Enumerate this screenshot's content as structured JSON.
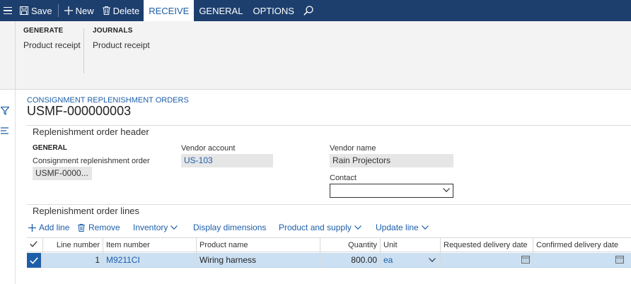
{
  "toolbar": {
    "save_label": "Save",
    "new_label": "New",
    "delete_label": "Delete",
    "tabs": [
      "RECEIVE",
      "GENERAL",
      "OPTIONS"
    ],
    "active_tab": "RECEIVE"
  },
  "ribbon": {
    "groups": [
      {
        "header": "GENERATE",
        "items": [
          "Product receipt"
        ]
      },
      {
        "header": "JOURNALS",
        "items": [
          "Product receipt"
        ]
      }
    ]
  },
  "page": {
    "breadcrumb": "CONSIGNMENT REPLENISHMENT ORDERS",
    "record_id": "USMF-000000003"
  },
  "header_tab": {
    "title": "Replenishment order header",
    "section_general": "GENERAL",
    "order_label": "Consignment replenishment order",
    "order_value": "USMF-0000...",
    "vendor_account_label": "Vendor account",
    "vendor_account_value": "US-103",
    "vendor_name_label": "Vendor name",
    "vendor_name_value": "Rain Projectors",
    "contact_label": "Contact",
    "contact_value": ""
  },
  "lines_tab": {
    "title": "Replenishment order lines",
    "actions": {
      "add_line": "Add line",
      "remove": "Remove",
      "inventory": "Inventory",
      "display_dimensions": "Display dimensions",
      "product_and_supply": "Product and supply",
      "update_line": "Update line"
    },
    "columns": [
      "Line number",
      "Item number",
      "Product name",
      "Quantity",
      "Unit",
      "Requested delivery date",
      "Confirmed delivery date"
    ],
    "rows": [
      {
        "line_number": "1",
        "item_number": "M9211CI",
        "product_name": "Wiring harness",
        "quantity": "800.00",
        "unit": "ea",
        "requested_delivery_date": "",
        "confirmed_delivery_date": "",
        "selected": true
      }
    ]
  },
  "colors": {
    "topbar": "#1d3f6e",
    "link": "#1d5ea8",
    "selected_row": "#cbe0f3"
  }
}
